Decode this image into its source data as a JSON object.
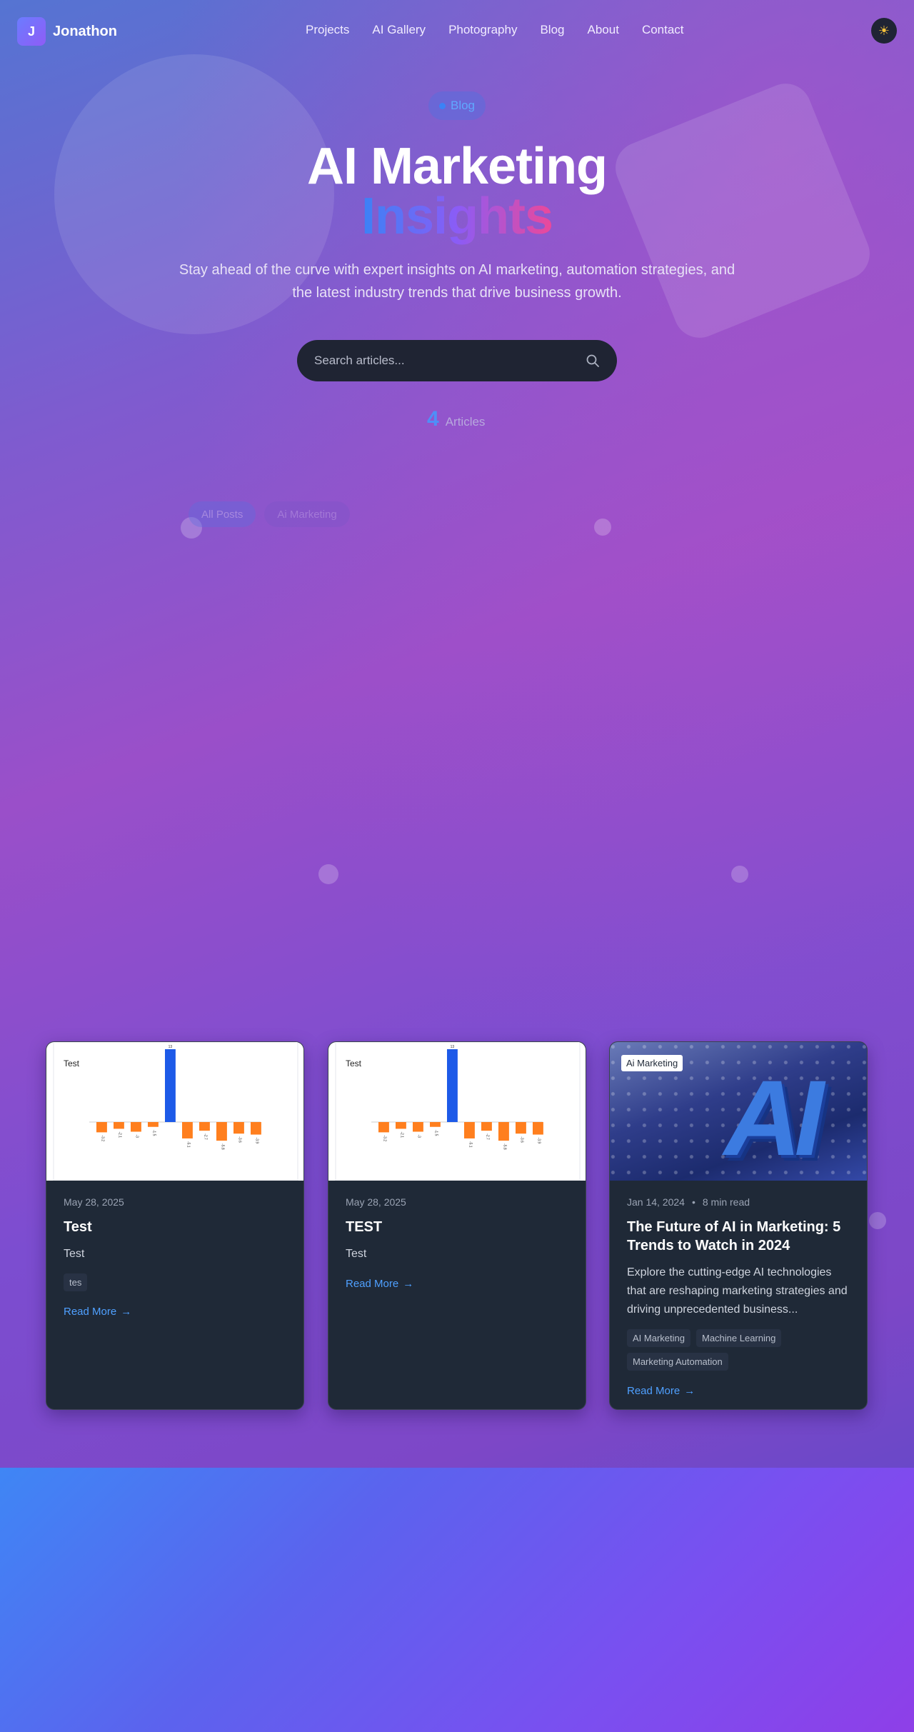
{
  "brand": {
    "initial": "J",
    "name": "Jonathon"
  },
  "nav": {
    "links": [
      "Projects",
      "AI Gallery",
      "Photography",
      "Blog",
      "About",
      "Contact"
    ]
  },
  "theme_toggle_icon": "sun-icon",
  "hero": {
    "badge": "Blog",
    "title_line1": "AI Marketing",
    "title_line2": "Insights",
    "subtitle": "Stay ahead of the curve with expert insights on AI marketing, automation strategies, and the latest industry trends that drive business growth.",
    "search_placeholder": "Search articles...",
    "count": "4",
    "count_label": "Articles"
  },
  "filters": [
    "All Posts",
    "Ai Marketing"
  ],
  "posts": [
    {
      "image_caption": "Test",
      "date": "May 28, 2025",
      "title": "Test",
      "excerpt": "Test",
      "tags": [
        "tes"
      ],
      "read_more": "Read More"
    },
    {
      "image_caption": "Test",
      "date": "May 28, 2025",
      "title": "TEST",
      "excerpt": "Test",
      "tags": [],
      "read_more": "Read More"
    },
    {
      "image_badge": "Ai Marketing",
      "image_text": "AI",
      "date": "Jan 14, 2024",
      "read_time": "8 min read",
      "title": "The Future of AI in Marketing: 5 Trends to Watch in 2024",
      "excerpt": "Explore the cutting-edge AI technologies that are reshaping marketing strategies and driving unprecedented business...",
      "tags": [
        "AI Marketing",
        "Machine Learning",
        "Marketing Automation"
      ],
      "read_more": "Read More"
    }
  ],
  "chart_data": [
    {
      "type": "bar",
      "title": "Test",
      "values": [
        -3.2,
        -2.1,
        -3.0,
        -1.5,
        13.0,
        -5.1,
        -2.7,
        -5.8,
        -3.6,
        -3.9
      ],
      "colors": {
        "positive": "#1d5ae8",
        "negative": "#ff7f1e"
      }
    },
    {
      "type": "bar",
      "title": "Test",
      "values": [
        -3.2,
        -2.1,
        -3.0,
        -1.5,
        13.0,
        -5.1,
        -2.7,
        -5.8,
        -3.6,
        -3.9
      ],
      "colors": {
        "positive": "#1d5ae8",
        "negative": "#ff7f1e"
      }
    }
  ],
  "colors": {
    "accent": "#4f8ff7",
    "card_bg": "#1f2937",
    "link": "#4fa0ff"
  }
}
